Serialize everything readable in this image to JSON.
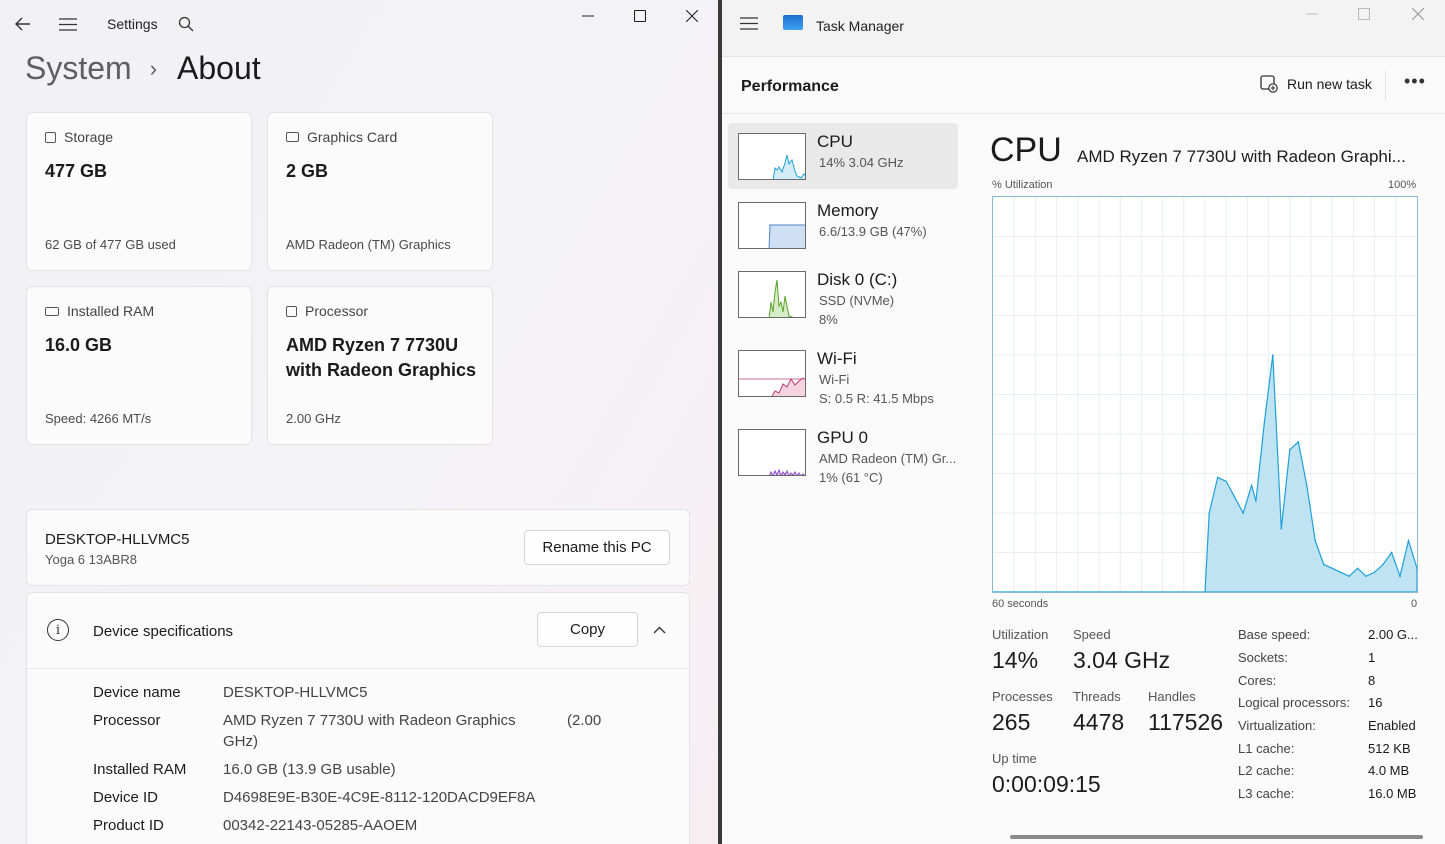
{
  "settings": {
    "title": "Settings",
    "breadcrumb": {
      "parent": "System",
      "current": "About"
    },
    "cards": [
      {
        "label": "Storage",
        "value": "477 GB",
        "sub": "62 GB of 477 GB used"
      },
      {
        "label": "Graphics Card",
        "value": "2 GB",
        "sub": "AMD Radeon (TM) Graphics"
      },
      {
        "label": "Installed RAM",
        "value": "16.0 GB",
        "sub": "Speed: 4266 MT/s"
      },
      {
        "label": "Processor",
        "value": "AMD Ryzen 7 7730U with Radeon Graphics",
        "sub": "2.00 GHz"
      }
    ],
    "pc": {
      "name": "DESKTOP-HLLVMC5",
      "model": "Yoga 6 13ABR8",
      "rename_label": "Rename this PC"
    },
    "specs": {
      "title": "Device specifications",
      "copy_label": "Copy",
      "rows": [
        {
          "key": "Device name",
          "value": "DESKTOP-HLLVMC5"
        },
        {
          "key": "Processor",
          "value": "AMD Ryzen 7 7730U with Radeon Graphics",
          "extra": "(2.00",
          "extra2": "GHz)"
        },
        {
          "key": "Installed RAM",
          "value": "16.0 GB (13.9 GB usable)"
        },
        {
          "key": "Device ID",
          "value": "D4698E9E-B30E-4C9E-8112-120DACD9EF8A"
        },
        {
          "key": "Product ID",
          "value": "00342-22143-05285-AAOEM"
        }
      ]
    }
  },
  "taskmgr": {
    "title": "Task Manager",
    "header": "Performance",
    "run_new_task": "Run new task",
    "more": "•••",
    "sidebar": [
      {
        "name": "CPU",
        "line2": "14%  3.04 GHz",
        "line3": "",
        "color": "#1da1d8",
        "fill": "#d3ecf7"
      },
      {
        "name": "Memory",
        "line2": "6.6/13.9 GB (47%)",
        "line3": "",
        "color": "#4b86c9",
        "fill": "#cfe0f4"
      },
      {
        "name": "Disk 0 (C:)",
        "line2": "SSD (NVMe)",
        "line3": "8%",
        "color": "#5aa22e",
        "fill": "#d6ecc7"
      },
      {
        "name": "Wi-Fi",
        "line2": "Wi-Fi",
        "line3": "S: 0.5  R: 41.5 Mbps",
        "color": "#c53a73",
        "fill": "#f5d3df"
      },
      {
        "name": "GPU 0",
        "line2": "AMD Radeon (TM) Gr...",
        "line3": "1% (61 °C)",
        "color": "#8b44c6",
        "fill": "#e6d6f4"
      }
    ],
    "cpu": {
      "title": "CPU",
      "model": "AMD Ryzen 7 7730U with Radeon Graphi...",
      "util_label": "% Utilization",
      "max_label": "100%",
      "time_label": "60 seconds",
      "zero_label": "0",
      "stats": {
        "utilization_label": "Utilization",
        "utilization": "14%",
        "speed_label": "Speed",
        "speed": "3.04 GHz",
        "processes_label": "Processes",
        "processes": "265",
        "threads_label": "Threads",
        "threads": "4478",
        "handles_label": "Handles",
        "handles": "117526",
        "uptime_label": "Up time",
        "uptime": "0:00:09:15"
      },
      "specs": [
        {
          "key": "Base speed:",
          "value": "2.00 G..."
        },
        {
          "key": "Sockets:",
          "value": "1"
        },
        {
          "key": "Cores:",
          "value": "8"
        },
        {
          "key": "Logical processors:",
          "value": "16"
        },
        {
          "key": "Virtualization:",
          "value": "Enabled"
        },
        {
          "key": "L1 cache:",
          "value": "512 KB"
        },
        {
          "key": "L2 cache:",
          "value": "4.0 MB"
        },
        {
          "key": "L3 cache:",
          "value": "16.0 MB"
        }
      ],
      "chart_data": {
        "type": "area",
        "xlabel": "60 seconds",
        "ylabel": "% Utilization",
        "ylim": [
          0,
          100
        ],
        "x": [
          0,
          50,
          51,
          53,
          55,
          57,
          59,
          61,
          62,
          64,
          66,
          68,
          70,
          72,
          74,
          76,
          78,
          80,
          82,
          84,
          86,
          88,
          90,
          92,
          94,
          96,
          98,
          100
        ],
        "values": [
          0,
          0,
          20,
          29,
          28,
          24,
          20,
          27,
          23,
          43,
          60,
          16,
          36,
          38,
          27,
          13,
          7,
          6,
          5,
          4,
          6,
          4,
          5,
          7,
          10,
          4,
          13,
          6
        ]
      }
    }
  }
}
